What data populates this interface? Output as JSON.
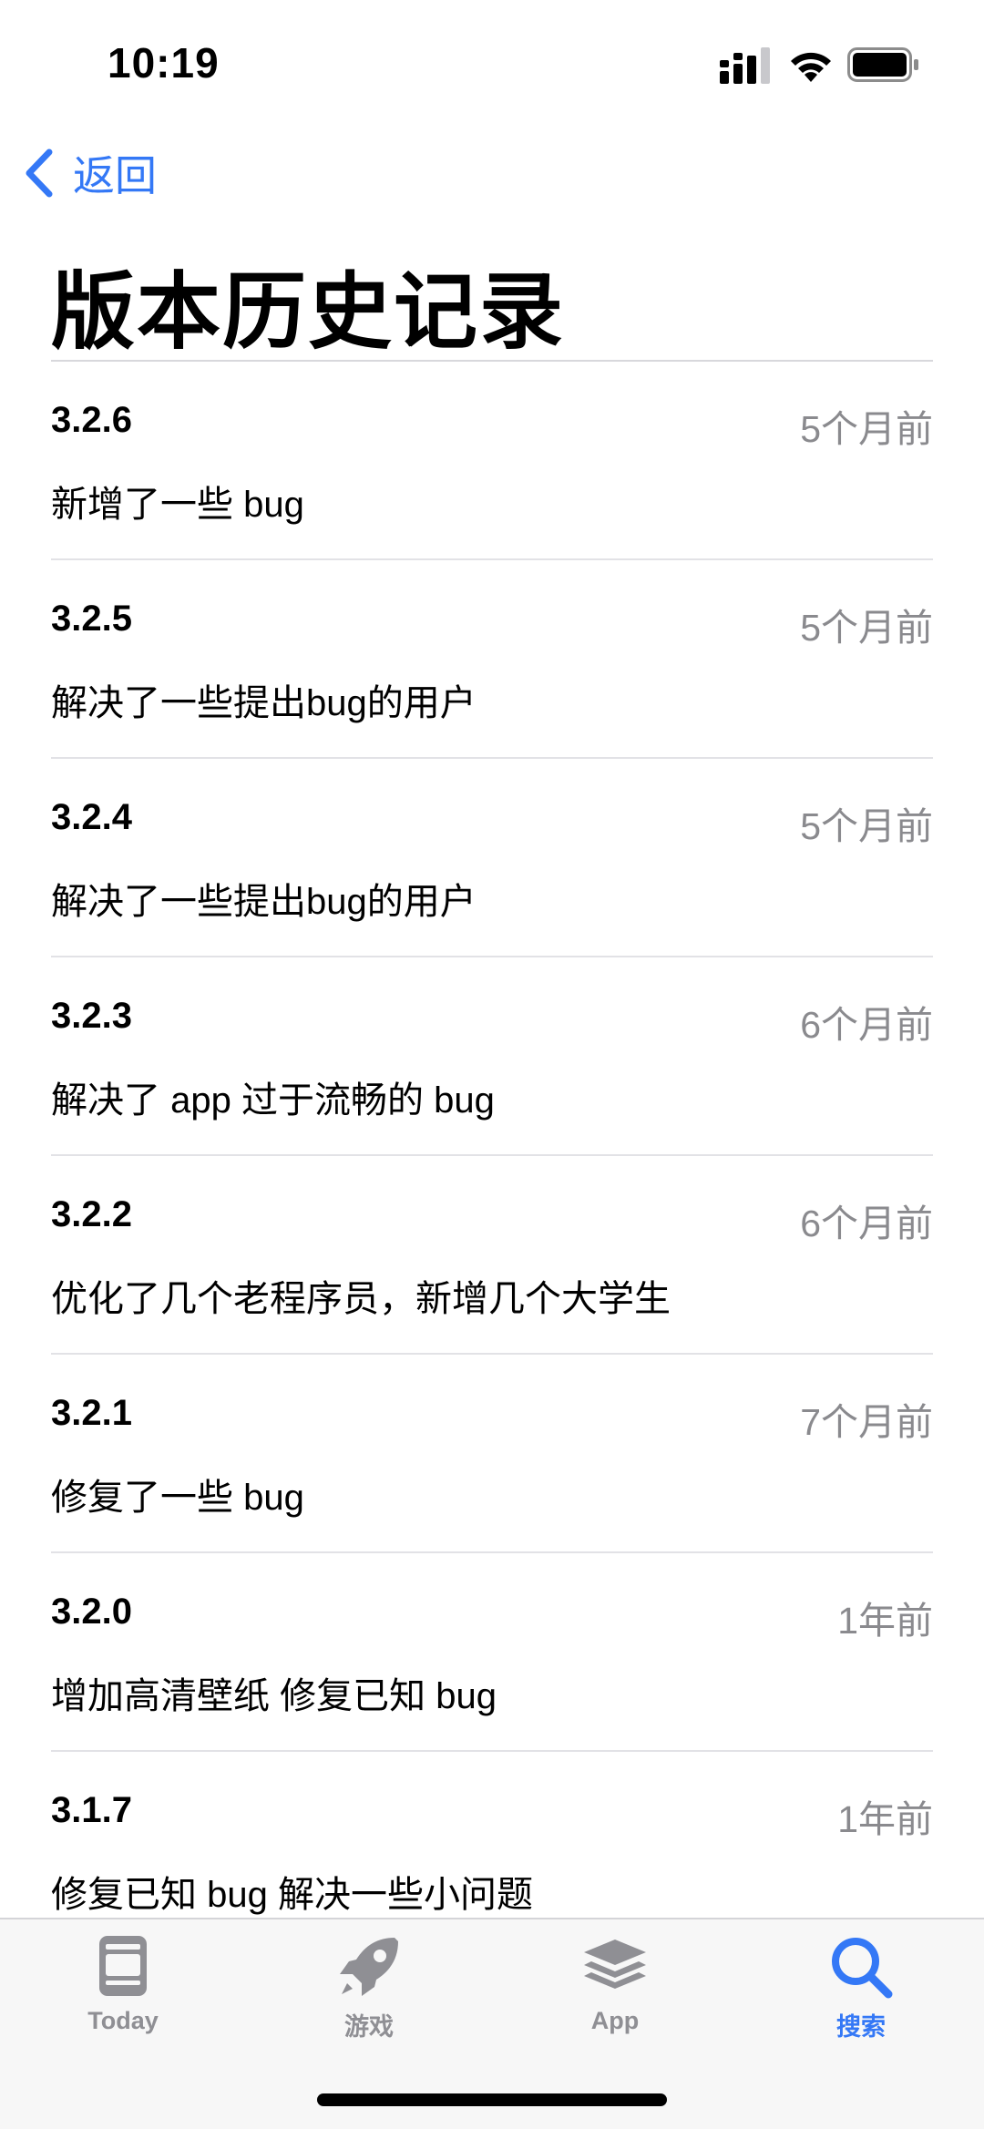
{
  "status_bar": {
    "time": "10:19"
  },
  "nav": {
    "back_label": "返回"
  },
  "page": {
    "title": "版本历史记录"
  },
  "versions": [
    {
      "number": "3.2.6",
      "date": "5个月前",
      "notes": "新增了一些 bug"
    },
    {
      "number": "3.2.5",
      "date": "5个月前",
      "notes": "解决了一些提出bug的用户"
    },
    {
      "number": "3.2.4",
      "date": "5个月前",
      "notes": "解决了一些提出bug的用户"
    },
    {
      "number": "3.2.3",
      "date": "6个月前",
      "notes": "解决了 app 过于流畅的 bug"
    },
    {
      "number": "3.2.2",
      "date": "6个月前",
      "notes": "优化了几个老程序员，新增几个大学生"
    },
    {
      "number": "3.2.1",
      "date": "7个月前",
      "notes": "修复了一些 bug"
    },
    {
      "number": "3.2.0",
      "date": "1年前",
      "notes": "增加高清壁纸 修复已知 bug"
    },
    {
      "number": "3.1.7",
      "date": "1年前",
      "notes": "修复已知 bug 解决一些小问题"
    }
  ],
  "tab_bar": {
    "tabs": [
      {
        "label": "Today",
        "icon": "today-icon"
      },
      {
        "label": "游戏",
        "icon": "rocket-icon"
      },
      {
        "label": "App",
        "icon": "layers-icon"
      },
      {
        "label": "搜索",
        "icon": "search-icon"
      }
    ],
    "active_index": 3
  },
  "colors": {
    "accent": "#3478f6",
    "secondary_text": "#8a8a8e",
    "tab_inactive": "#8f8f94"
  }
}
